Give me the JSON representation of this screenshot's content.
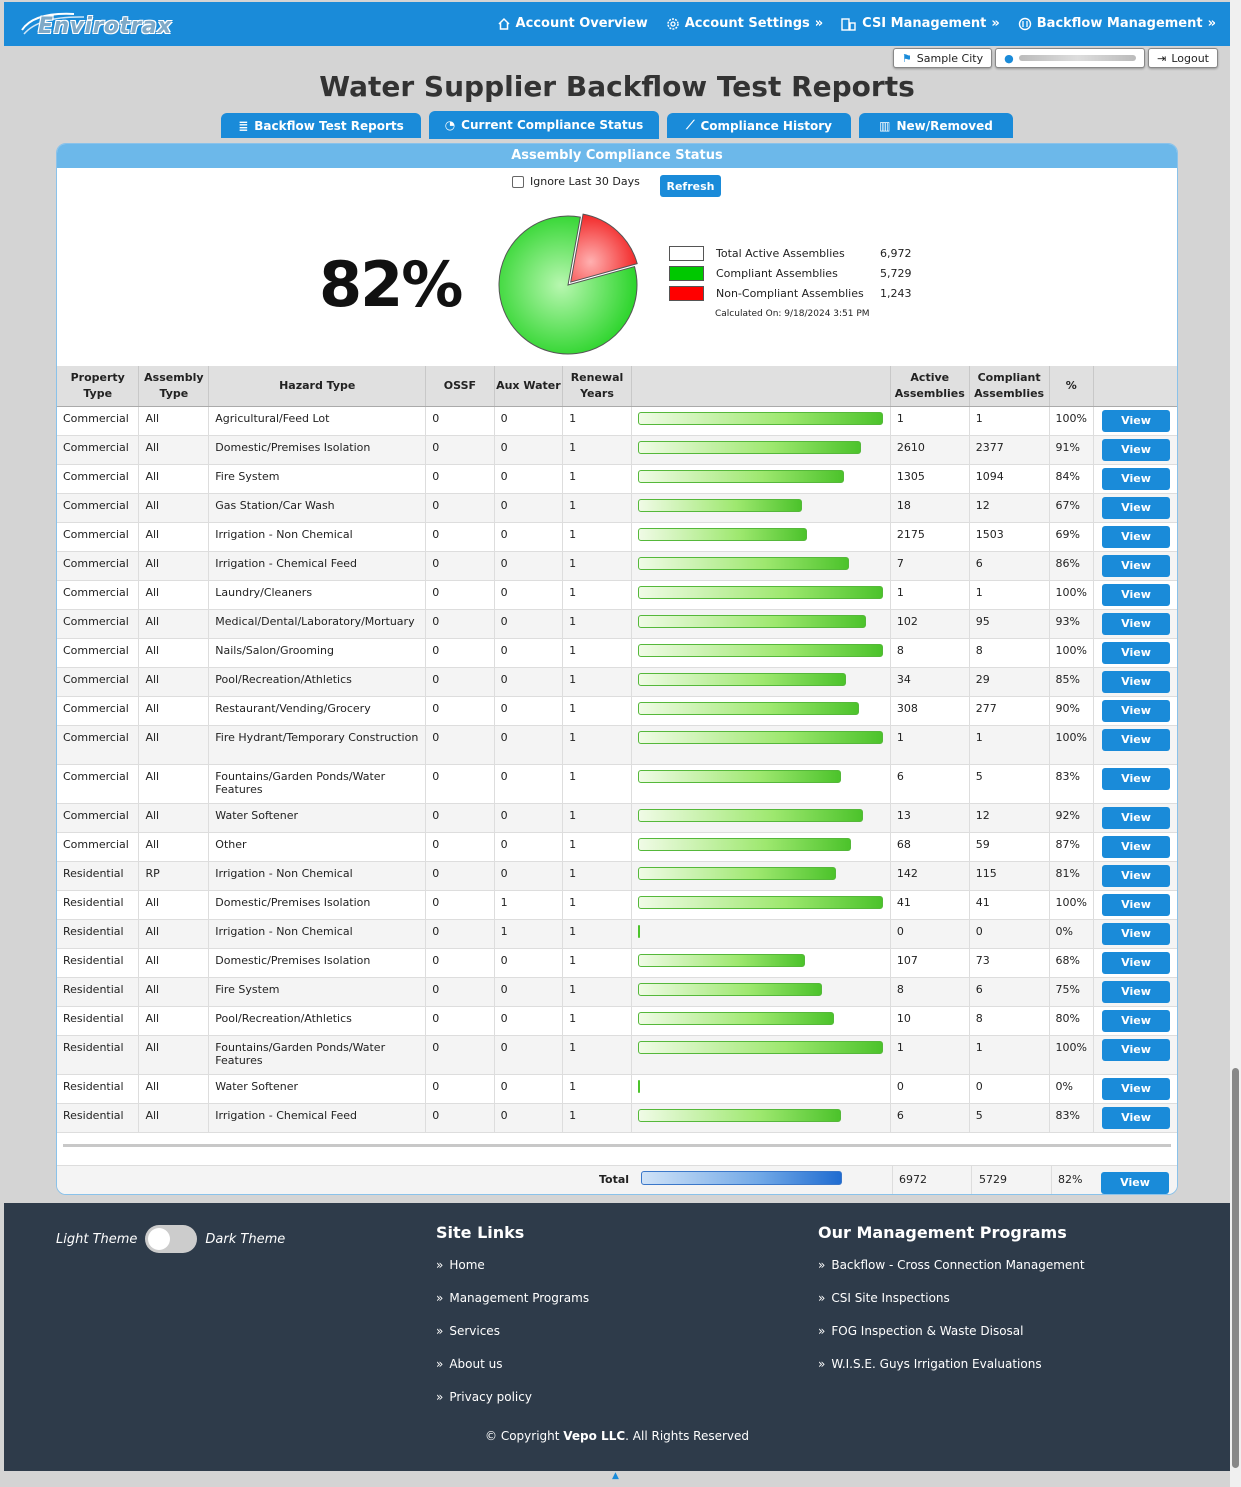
{
  "nav": {
    "logo": "Envirotrax",
    "items": [
      {
        "label": "Account Overview",
        "icon": "home-icon"
      },
      {
        "label": "Account Settings",
        "icon": "gear-icon"
      },
      {
        "label": "CSI Management",
        "icon": "building-icon"
      },
      {
        "label": "Backflow Management",
        "icon": "backflow-icon"
      }
    ]
  },
  "userbar": {
    "city": "Sample City",
    "logout": "Logout"
  },
  "title": "Water Supplier Backflow Test Reports",
  "tabs": [
    {
      "label": "Backflow Test Reports",
      "icon": "list-icon"
    },
    {
      "label": "Current Compliance Status",
      "icon": "pie-chart-icon"
    },
    {
      "label": "Compliance History",
      "icon": "line-chart-icon"
    },
    {
      "label": "New/Removed",
      "icon": "bar-chart-icon"
    }
  ],
  "panel": {
    "title": "Assembly Compliance Status",
    "ignore_label": "Ignore Last 30 Days",
    "refresh": "Refresh",
    "percent": "82%",
    "legend": [
      {
        "label": "Total Active Assemblies",
        "value": "6,972",
        "color": "#ffffff"
      },
      {
        "label": "Compliant Assemblies",
        "value": "5,729",
        "color": "#00c800"
      },
      {
        "label": "Non-Compliant Assemblies",
        "value": "1,243",
        "color": "#ff0000"
      }
    ],
    "calculated": "Calculated On: 9/18/2024 3:51 PM"
  },
  "chart_data": {
    "type": "pie",
    "categories": [
      "Compliant Assemblies",
      "Non-Compliant Assemblies"
    ],
    "values": [
      5729,
      1243
    ]
  },
  "table": {
    "headers": [
      "Property Type",
      "Assembly Type",
      "Hazard Type",
      "OSSF",
      "Aux Water",
      "Renewal Years",
      "",
      "Active Assemblies",
      "Compliant Assemblies",
      "%",
      ""
    ],
    "view": "View",
    "rows": [
      {
        "prop": "Commercial",
        "asm": "All",
        "hazard": "Agricultural/Feed Lot",
        "ossf": "0",
        "aux": "0",
        "renew": "1",
        "active": "1",
        "comp": "1",
        "pct": "100%",
        "frac": 1.0
      },
      {
        "prop": "Commercial",
        "asm": "All",
        "hazard": "Domestic/Premises Isolation",
        "ossf": "0",
        "aux": "0",
        "renew": "1",
        "active": "2610",
        "comp": "2377",
        "pct": "91%",
        "frac": 0.91
      },
      {
        "prop": "Commercial",
        "asm": "All",
        "hazard": "Fire System",
        "ossf": "0",
        "aux": "0",
        "renew": "1",
        "active": "1305",
        "comp": "1094",
        "pct": "84%",
        "frac": 0.84
      },
      {
        "prop": "Commercial",
        "asm": "All",
        "hazard": "Gas Station/Car Wash",
        "ossf": "0",
        "aux": "0",
        "renew": "1",
        "active": "18",
        "comp": "12",
        "pct": "67%",
        "frac": 0.67
      },
      {
        "prop": "Commercial",
        "asm": "All",
        "hazard": "Irrigation - Non Chemical",
        "ossf": "0",
        "aux": "0",
        "renew": "1",
        "active": "2175",
        "comp": "1503",
        "pct": "69%",
        "frac": 0.69
      },
      {
        "prop": "Commercial",
        "asm": "All",
        "hazard": "Irrigation - Chemical Feed",
        "ossf": "0",
        "aux": "0",
        "renew": "1",
        "active": "7",
        "comp": "6",
        "pct": "86%",
        "frac": 0.86
      },
      {
        "prop": "Commercial",
        "asm": "All",
        "hazard": "Laundry/Cleaners",
        "ossf": "0",
        "aux": "0",
        "renew": "1",
        "active": "1",
        "comp": "1",
        "pct": "100%",
        "frac": 1.0
      },
      {
        "prop": "Commercial",
        "asm": "All",
        "hazard": "Medical/Dental/Laboratory/Mortuary",
        "ossf": "0",
        "aux": "0",
        "renew": "1",
        "active": "102",
        "comp": "95",
        "pct": "93%",
        "frac": 0.93
      },
      {
        "prop": "Commercial",
        "asm": "All",
        "hazard": "Nails/Salon/Grooming",
        "ossf": "0",
        "aux": "0",
        "renew": "1",
        "active": "8",
        "comp": "8",
        "pct": "100%",
        "frac": 1.0
      },
      {
        "prop": "Commercial",
        "asm": "All",
        "hazard": "Pool/Recreation/Athletics",
        "ossf": "0",
        "aux": "0",
        "renew": "1",
        "active": "34",
        "comp": "29",
        "pct": "85%",
        "frac": 0.85
      },
      {
        "prop": "Commercial",
        "asm": "All",
        "hazard": "Restaurant/Vending/Grocery",
        "ossf": "0",
        "aux": "0",
        "renew": "1",
        "active": "308",
        "comp": "277",
        "pct": "90%",
        "frac": 0.9
      },
      {
        "prop": "Commercial",
        "asm": "All",
        "hazard": "Fire Hydrant/Temporary Construction",
        "ossf": "0",
        "aux": "0",
        "renew": "1",
        "active": "1",
        "comp": "1",
        "pct": "100%",
        "frac": 1.0,
        "tall": true
      },
      {
        "prop": "Commercial",
        "asm": "All",
        "hazard": "Fountains/Garden Ponds/Water Features",
        "ossf": "0",
        "aux": "0",
        "renew": "1",
        "active": "6",
        "comp": "5",
        "pct": "83%",
        "frac": 0.83,
        "tall": true
      },
      {
        "prop": "Commercial",
        "asm": "All",
        "hazard": "Water Softener",
        "ossf": "0",
        "aux": "0",
        "renew": "1",
        "active": "13",
        "comp": "12",
        "pct": "92%",
        "frac": 0.92
      },
      {
        "prop": "Commercial",
        "asm": "All",
        "hazard": "Other",
        "ossf": "0",
        "aux": "0",
        "renew": "1",
        "active": "68",
        "comp": "59",
        "pct": "87%",
        "frac": 0.87
      },
      {
        "prop": "Residential",
        "asm": "RP",
        "hazard": "Irrigation - Non Chemical",
        "ossf": "0",
        "aux": "0",
        "renew": "1",
        "active": "142",
        "comp": "115",
        "pct": "81%",
        "frac": 0.81
      },
      {
        "prop": "Residential",
        "asm": "All",
        "hazard": "Domestic/Premises Isolation",
        "ossf": "0",
        "aux": "1",
        "renew": "1",
        "active": "41",
        "comp": "41",
        "pct": "100%",
        "frac": 1.0
      },
      {
        "prop": "Residential",
        "asm": "All",
        "hazard": "Irrigation - Non Chemical",
        "ossf": "0",
        "aux": "1",
        "renew": "1",
        "active": "0",
        "comp": "0",
        "pct": "0%",
        "frac": 0
      },
      {
        "prop": "Residential",
        "asm": "All",
        "hazard": "Domestic/Premises Isolation",
        "ossf": "0",
        "aux": "0",
        "renew": "1",
        "active": "107",
        "comp": "73",
        "pct": "68%",
        "frac": 0.68
      },
      {
        "prop": "Residential",
        "asm": "All",
        "hazard": "Fire System",
        "ossf": "0",
        "aux": "0",
        "renew": "1",
        "active": "8",
        "comp": "6",
        "pct": "75%",
        "frac": 0.75
      },
      {
        "prop": "Residential",
        "asm": "All",
        "hazard": "Pool/Recreation/Athletics",
        "ossf": "0",
        "aux": "0",
        "renew": "1",
        "active": "10",
        "comp": "8",
        "pct": "80%",
        "frac": 0.8
      },
      {
        "prop": "Residential",
        "asm": "All",
        "hazard": "Fountains/Garden Ponds/Water Features",
        "ossf": "0",
        "aux": "0",
        "renew": "1",
        "active": "1",
        "comp": "1",
        "pct": "100%",
        "frac": 1.0,
        "tall": true
      },
      {
        "prop": "Residential",
        "asm": "All",
        "hazard": "Water Softener",
        "ossf": "0",
        "aux": "0",
        "renew": "1",
        "active": "0",
        "comp": "0",
        "pct": "0%",
        "frac": 0
      },
      {
        "prop": "Residential",
        "asm": "All",
        "hazard": "Irrigation - Chemical Feed",
        "ossf": "0",
        "aux": "0",
        "renew": "1",
        "active": "6",
        "comp": "5",
        "pct": "83%",
        "frac": 0.83
      }
    ],
    "total": {
      "label": "Total",
      "active": "6972",
      "comp": "5729",
      "pct": "82%",
      "frac": 0.82
    }
  },
  "footer": {
    "light": "Light Theme",
    "dark": "Dark Theme",
    "site_links_title": "Site Links",
    "site_links": [
      "Home",
      "Management Programs",
      "Services",
      "About us",
      "Privacy policy"
    ],
    "programs_title": "Our Management Programs",
    "programs": [
      "Backflow - Cross Connection Management",
      "CSI Site Inspections",
      "FOG Inspection & Waste Disosal",
      "W.I.S.E. Guys Irrigation Evaluations"
    ],
    "copyright_pre": "© Copyright ",
    "copyright_company": "Vepo LLC",
    "copyright_post": ". All Rights Reserved"
  }
}
